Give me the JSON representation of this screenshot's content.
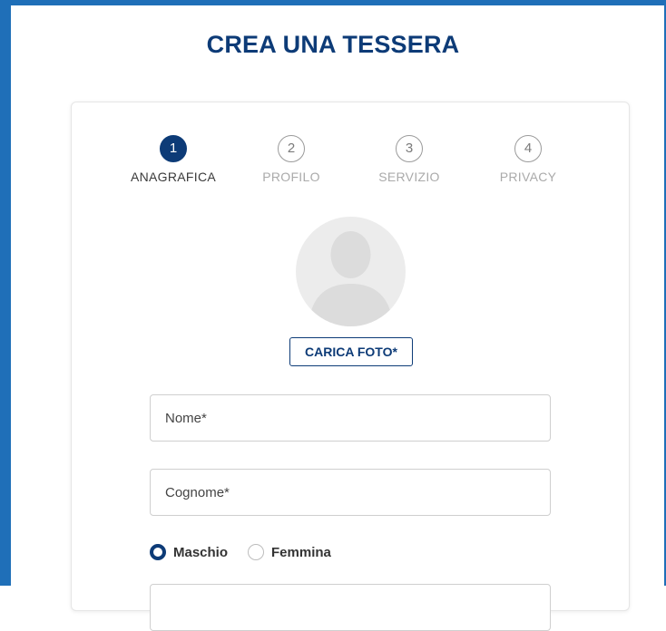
{
  "page": {
    "title": "CREA UNA TESSERA"
  },
  "stepper": {
    "steps": [
      {
        "number": "1",
        "label": "ANAGRAFICA",
        "active": true
      },
      {
        "number": "2",
        "label": "PROFILO",
        "active": false
      },
      {
        "number": "3",
        "label": "SERVIZIO",
        "active": false
      },
      {
        "number": "4",
        "label": "PRIVACY",
        "active": false
      }
    ]
  },
  "photo": {
    "icon": "user-silhouette-icon",
    "upload_label": "CARICA FOTO*"
  },
  "form": {
    "nome": {
      "placeholder": "Nome*",
      "value": ""
    },
    "cognome": {
      "placeholder": "Cognome*",
      "value": ""
    },
    "gender": {
      "options": [
        {
          "label": "Maschio",
          "selected": true
        },
        {
          "label": "Femmina",
          "selected": false
        }
      ]
    }
  },
  "colors": {
    "brand": "#0d3b77",
    "frame": "#1f6fb8",
    "inactive": "#aaaaaa"
  }
}
